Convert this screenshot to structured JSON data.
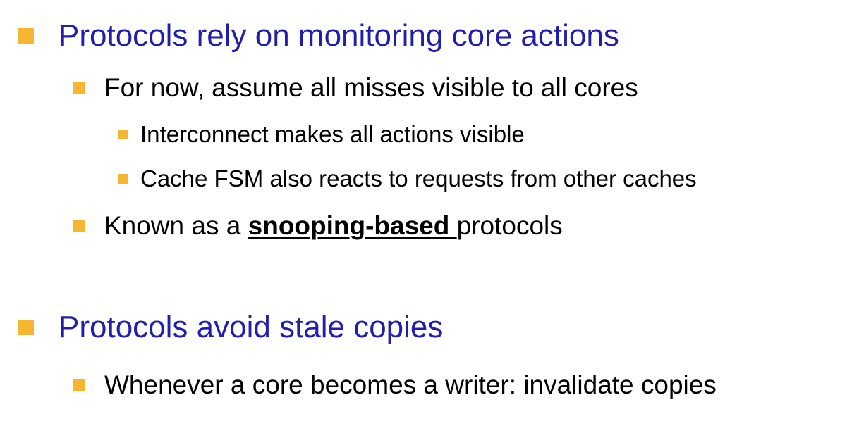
{
  "colors": {
    "bullet": "#F5B632",
    "heading": "#1F1FAB",
    "body_text": "#000000"
  },
  "slide": {
    "section1": {
      "heading": "Protocols rely on monitoring core actions",
      "point1": "For now, assume all misses visible to all cores",
      "sub1": "Interconnect makes all actions visible",
      "sub2": "Cache FSM also reacts to requests from other caches",
      "point2_prefix": "Known as a ",
      "point2_emph": "snooping-based ",
      "point2_suffix": "protocols"
    },
    "section2": {
      "heading": "Protocols avoid stale copies",
      "point1": "Whenever a core becomes a writer: invalidate copies"
    }
  }
}
